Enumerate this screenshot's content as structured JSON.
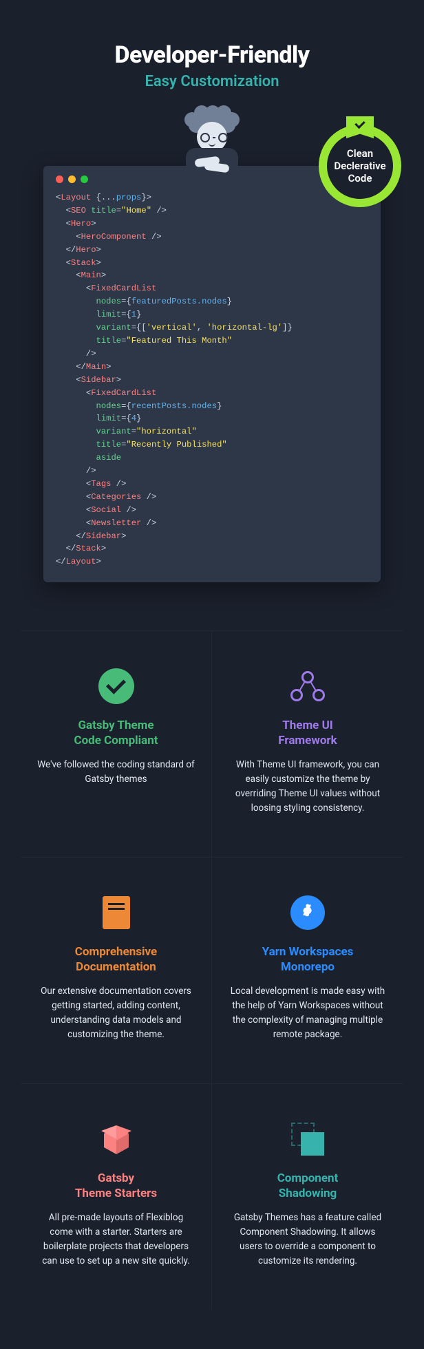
{
  "hero": {
    "title": "Developer-Friendly",
    "subtitle": "Easy Customization"
  },
  "badge": {
    "line1": "Clean",
    "line2": "Declerative",
    "line3": "Code"
  },
  "code": {
    "lines": [
      {
        "indent": 0,
        "parts": [
          {
            "cls": "p",
            "t": "<"
          },
          {
            "cls": "t",
            "t": "Layout"
          },
          {
            "cls": "p",
            "t": " {..."
          },
          {
            "cls": "b",
            "t": "props"
          },
          {
            "cls": "p",
            "t": "}>"
          }
        ]
      },
      {
        "indent": 1,
        "parts": [
          {
            "cls": "p",
            "t": "<"
          },
          {
            "cls": "t",
            "t": "SEO"
          },
          {
            "cls": "p",
            "t": " "
          },
          {
            "cls": "a",
            "t": "title"
          },
          {
            "cls": "p",
            "t": "="
          },
          {
            "cls": "s",
            "t": "\"Home\""
          },
          {
            "cls": "p",
            "t": " />"
          }
        ]
      },
      {
        "indent": 1,
        "parts": [
          {
            "cls": "p",
            "t": "<"
          },
          {
            "cls": "t",
            "t": "Hero"
          },
          {
            "cls": "p",
            "t": ">"
          }
        ]
      },
      {
        "indent": 2,
        "parts": [
          {
            "cls": "p",
            "t": "<"
          },
          {
            "cls": "t",
            "t": "HeroComponent"
          },
          {
            "cls": "p",
            "t": " />"
          }
        ]
      },
      {
        "indent": 1,
        "parts": [
          {
            "cls": "p",
            "t": "</"
          },
          {
            "cls": "t",
            "t": "Hero"
          },
          {
            "cls": "p",
            "t": ">"
          }
        ]
      },
      {
        "indent": 1,
        "parts": [
          {
            "cls": "p",
            "t": "<"
          },
          {
            "cls": "t",
            "t": "Stack"
          },
          {
            "cls": "p",
            "t": ">"
          }
        ]
      },
      {
        "indent": 2,
        "parts": [
          {
            "cls": "p",
            "t": "<"
          },
          {
            "cls": "t",
            "t": "Main"
          },
          {
            "cls": "p",
            "t": ">"
          }
        ]
      },
      {
        "indent": 3,
        "parts": [
          {
            "cls": "p",
            "t": "<"
          },
          {
            "cls": "t",
            "t": "FixedCardList"
          }
        ]
      },
      {
        "indent": 4,
        "parts": [
          {
            "cls": "a",
            "t": "nodes"
          },
          {
            "cls": "p",
            "t": "={"
          },
          {
            "cls": "b",
            "t": "featuredPosts.nodes"
          },
          {
            "cls": "p",
            "t": "}"
          }
        ]
      },
      {
        "indent": 4,
        "parts": [
          {
            "cls": "a",
            "t": "limit"
          },
          {
            "cls": "p",
            "t": "={"
          },
          {
            "cls": "b",
            "t": "1"
          },
          {
            "cls": "p",
            "t": "}"
          }
        ]
      },
      {
        "indent": 4,
        "parts": [
          {
            "cls": "a",
            "t": "variant"
          },
          {
            "cls": "p",
            "t": "={["
          },
          {
            "cls": "s",
            "t": "'vertical'"
          },
          {
            "cls": "p",
            "t": ", "
          },
          {
            "cls": "s",
            "t": "'horizontal-lg'"
          },
          {
            "cls": "p",
            "t": "]}"
          }
        ]
      },
      {
        "indent": 4,
        "parts": [
          {
            "cls": "a",
            "t": "title"
          },
          {
            "cls": "p",
            "t": "="
          },
          {
            "cls": "s",
            "t": "\"Featured This Month\""
          }
        ]
      },
      {
        "indent": 3,
        "parts": [
          {
            "cls": "p",
            "t": "/>"
          }
        ]
      },
      {
        "indent": 2,
        "parts": [
          {
            "cls": "p",
            "t": "</"
          },
          {
            "cls": "t",
            "t": "Main"
          },
          {
            "cls": "p",
            "t": ">"
          }
        ]
      },
      {
        "indent": 2,
        "parts": [
          {
            "cls": "p",
            "t": "<"
          },
          {
            "cls": "t",
            "t": "Sidebar"
          },
          {
            "cls": "p",
            "t": ">"
          }
        ]
      },
      {
        "indent": 3,
        "parts": [
          {
            "cls": "p",
            "t": "<"
          },
          {
            "cls": "t",
            "t": "FixedCardList"
          }
        ]
      },
      {
        "indent": 4,
        "parts": [
          {
            "cls": "a",
            "t": "nodes"
          },
          {
            "cls": "p",
            "t": "={"
          },
          {
            "cls": "b",
            "t": "recentPosts.nodes"
          },
          {
            "cls": "p",
            "t": "}"
          }
        ]
      },
      {
        "indent": 4,
        "parts": [
          {
            "cls": "a",
            "t": "limit"
          },
          {
            "cls": "p",
            "t": "={"
          },
          {
            "cls": "b",
            "t": "4"
          },
          {
            "cls": "p",
            "t": "}"
          }
        ]
      },
      {
        "indent": 4,
        "parts": [
          {
            "cls": "a",
            "t": "variant"
          },
          {
            "cls": "p",
            "t": "="
          },
          {
            "cls": "s",
            "t": "\"horizontal\""
          }
        ]
      },
      {
        "indent": 4,
        "parts": [
          {
            "cls": "a",
            "t": "title"
          },
          {
            "cls": "p",
            "t": "="
          },
          {
            "cls": "s",
            "t": "\"Recently Published\""
          }
        ]
      },
      {
        "indent": 4,
        "parts": [
          {
            "cls": "a",
            "t": "aside"
          }
        ]
      },
      {
        "indent": 3,
        "parts": [
          {
            "cls": "p",
            "t": "/>"
          }
        ]
      },
      {
        "indent": 3,
        "parts": [
          {
            "cls": "p",
            "t": "<"
          },
          {
            "cls": "t",
            "t": "Tags"
          },
          {
            "cls": "p",
            "t": " />"
          }
        ]
      },
      {
        "indent": 3,
        "parts": [
          {
            "cls": "p",
            "t": "<"
          },
          {
            "cls": "t",
            "t": "Categories"
          },
          {
            "cls": "p",
            "t": " />"
          }
        ]
      },
      {
        "indent": 3,
        "parts": [
          {
            "cls": "p",
            "t": "<"
          },
          {
            "cls": "t",
            "t": "Social"
          },
          {
            "cls": "p",
            "t": " />"
          }
        ]
      },
      {
        "indent": 3,
        "parts": [
          {
            "cls": "p",
            "t": "<"
          },
          {
            "cls": "t",
            "t": "Newsletter"
          },
          {
            "cls": "p",
            "t": " />"
          }
        ]
      },
      {
        "indent": 2,
        "parts": [
          {
            "cls": "p",
            "t": "</"
          },
          {
            "cls": "t",
            "t": "Sidebar"
          },
          {
            "cls": "p",
            "t": ">"
          }
        ]
      },
      {
        "indent": 1,
        "parts": [
          {
            "cls": "p",
            "t": "</"
          },
          {
            "cls": "t",
            "t": "Stack"
          },
          {
            "cls": "p",
            "t": ">"
          }
        ]
      },
      {
        "indent": 0,
        "parts": [
          {
            "cls": "p",
            "t": "</"
          },
          {
            "cls": "t",
            "t": "Layout"
          },
          {
            "cls": "p",
            "t": ">"
          }
        ]
      }
    ]
  },
  "features": [
    {
      "icon": "check",
      "color": "c-green",
      "title": "Gatsby Theme\nCode Compliant",
      "body": "We've followed the coding standard of Gatsby themes"
    },
    {
      "icon": "theme",
      "color": "c-purple",
      "title": "Theme UI\nFramework",
      "body": "With Theme UI framework, you can easily customize the theme by overriding Theme UI values without loosing styling consistency."
    },
    {
      "icon": "doc",
      "color": "c-orange",
      "title": "Comprehensive\nDocumentation",
      "body": "Our extensive documentation covers getting started, adding content, understanding data models and customizing the theme."
    },
    {
      "icon": "yarn",
      "color": "c-blue",
      "title": "Yarn Workspaces\nMonorepo",
      "body": "Local development is made easy with the help of Yarn Workspaces without the complexity of managing multiple remote package."
    },
    {
      "icon": "box",
      "color": "c-pink",
      "title": "Gatsby\nTheme Starters",
      "body": "All pre-made layouts of Flexiblog come with a starter. Starters are boilerplate projects that developers can use to set up a new site quickly."
    },
    {
      "icon": "shadow",
      "color": "c-teal",
      "title": "Component\nShadowing",
      "body": "Gatsby Themes has a feature called Component Shadowing. It allows users to override a component to customize its rendering."
    }
  ]
}
